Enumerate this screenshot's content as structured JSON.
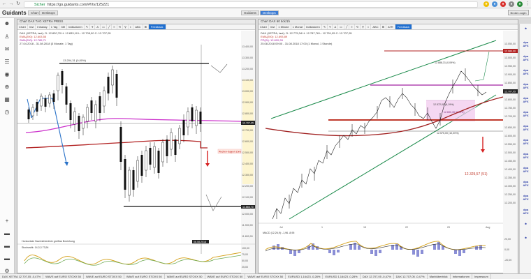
{
  "browser": {
    "url_secure": "Sicher",
    "url": "https://go.guidants.com/#!/tv/125221"
  },
  "app": {
    "logo": "Guidants",
    "tabs": [
      "Chart",
      "Desktops"
    ],
    "right_tabs": [
      "Guidants",
      "Desktops"
    ],
    "broker_button": "Broker-Login"
  },
  "left_panel": {
    "title": "Chart DAX TAG XETRA PREIS",
    "toolbar": [
      "Chart",
      "Inst",
      "Intraday",
      "1 Tag",
      "3M",
      "Indikatoren",
      "Feedback"
    ],
    "legend": [
      "DAX (XETRA, last): O: 12.820,70 H: 12.833,10 L: 12.705,00 C: 12.707,05",
      "EMA(200): 12.603,55",
      "SMA(200): 12.785,71",
      "27.04.2018 - 31.08.2018 (3 Monate, 1 Tag)"
    ],
    "price_ticks": [
      "13.400,00",
      "13.300,00",
      "13.200,00",
      "13.100,00",
      "13.000,00",
      "12.900,00",
      "12.800,00",
      "12.700,00",
      "12.600,00",
      "12.500,00",
      "12.400,00",
      "12.300,00",
      "12.200,00",
      "12.100,00",
      "12.000,00",
      "11.900,00",
      "11.800,00",
      "11.700,00"
    ],
    "price_tag": "12.707,05",
    "top_label": "13.204,31 (0,00%)",
    "right_label": "Wochen-Support Zone",
    "bottom_tag": "11.866,70",
    "date_tag": "06.08.2018",
    "indicator_label": "Horizontale Nachrichtenlinie greifbar Beziehung",
    "indicator_legend": "Stochastik: 14,3,3  73,54",
    "ind_ticks": [
      "100,00",
      "75,00",
      "50,00",
      "25,00"
    ]
  },
  "right_panel": {
    "title": "Chart DAX 60 tick/1h",
    "toolbar": [
      "Chart",
      "Inst",
      "1 Minute",
      "1 Monat",
      "Indikatoren",
      "Feedback"
    ],
    "legend": [
      "DAX (XETRA, last): O: 12.775,34 H: 12.787,78 L: 12.751,05 C: 12.707,05",
      "EMA(200): 12.693,89",
      "PP(W): 12.820,28",
      "25.08.2018 09:00 - 31.08.2018 17:00 (1 Monat, 1 Stunde)"
    ],
    "price_ticks": [
      "13.050,00",
      "13.000,00",
      "12.950,00",
      "12.900,00",
      "12.850,00",
      "12.800,00",
      "12.750,00",
      "12.700,00",
      "12.650,00",
      "12.600,00",
      "12.550,00",
      "12.500,00",
      "12.450,00",
      "12.400,00",
      "12.350,00",
      "12.300,00",
      "12.250,00",
      "12.200,00"
    ],
    "red_line_tag": "12.980,00",
    "price_tag": "12.707,05",
    "label_top": "12.888,31 (0,09%)",
    "label_pink": "12.690,35 (0,09%)",
    "label_mid": "12.572,00 (8,19%)",
    "label_low": "12.575,00 (10,00%)",
    "target_label": "12.329,57 (51)",
    "x_ticks": [
      "Jul",
      "1",
      "15",
      "22",
      "29",
      "Aug"
    ],
    "ind_ticks": [
      "20,00",
      "0,00",
      "-20,00"
    ],
    "ind_legend": "MACD (12,26,9): -1,96  -8,95"
  },
  "ticker": [
    "DAX XETRA 12.707,05 -0,47%",
    "WAVE auf EURO STOXX 50",
    "WAVE auf EURO STOXX 50",
    "WAVE auf EURO STOXX 50",
    "WAVE auf EURO STOXX 50",
    "WAVE auf EURO STOXX 50",
    "WAVE auf EURO STOXX 50",
    "EURUSD 1,16423 -0,28%",
    "EURUSD 1,16423 -0,28%",
    "DAX 12.707,05 -0,47%",
    "DAX 12.707,05 -0,47%",
    "Marktüberblick",
    "Informationen",
    "Impressum"
  ]
}
